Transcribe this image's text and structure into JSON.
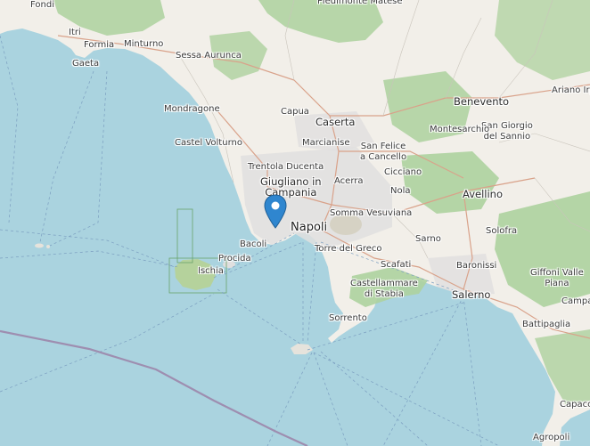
{
  "map": {
    "colors": {
      "sea": "#aad3df",
      "land": "#f2efe9",
      "forest": "#add19e",
      "urban": "#e0dfdf",
      "pin": "#2f86cf",
      "ferry": "#7b9ec0",
      "boundary": "#9e8eb0"
    },
    "marker": {
      "icon": "map-pin-icon"
    },
    "places": {
      "fondi": "Fondi",
      "piedimonte_matese": "Piedimonte Matese",
      "itri": "Itri",
      "formia": "Formia",
      "minturno": "Minturno",
      "gaeta": "Gaeta",
      "sessa_aurunca": "Sessa Aurunca",
      "benevento": "Benevento",
      "ariano_irpino": "Ariano Irp",
      "san_giorgio_line1": "San Giorgio",
      "san_giorgio_line2": "del Sannio",
      "mondragone": "Mondragone",
      "capua": "Capua",
      "caserta": "Caserta",
      "montesarchio": "Montesarchio",
      "castel_volturno": "Castel Volturno",
      "marcianise": "Marcianise",
      "san_felice_line1": "San Felice",
      "san_felice_line2": "a Cancello",
      "trentola_ducenta": "Trentola Ducenta",
      "cicciano": "Cicciano",
      "giugliano_line1": "Giugliano in",
      "giugliano_line2": "Campania",
      "acerra": "Acerra",
      "nola": "Nola",
      "avellino": "Avellino",
      "somma_vesuviana": "Somma Vesuviana",
      "napoli": "Napoli",
      "solofra": "Solofra",
      "bacoli": "Bacoli",
      "sarno": "Sarno",
      "torre_del_greco": "Torre del Greco",
      "procida": "Procida",
      "ischia": "Ischia",
      "scafati": "Scafati",
      "baronissi": "Baronissi",
      "giffoni_line1": "Giffoni Valle",
      "giffoni_line2": "Piana",
      "castellammare_line1": "Castellammare",
      "castellammare_line2": "di Stabia",
      "salerno": "Salerno",
      "campagna": "Campa",
      "sorrento": "Sorrento",
      "battipaglia": "Battipaglia",
      "capaccio": "Capacci",
      "agropoli": "Agropoli"
    }
  }
}
